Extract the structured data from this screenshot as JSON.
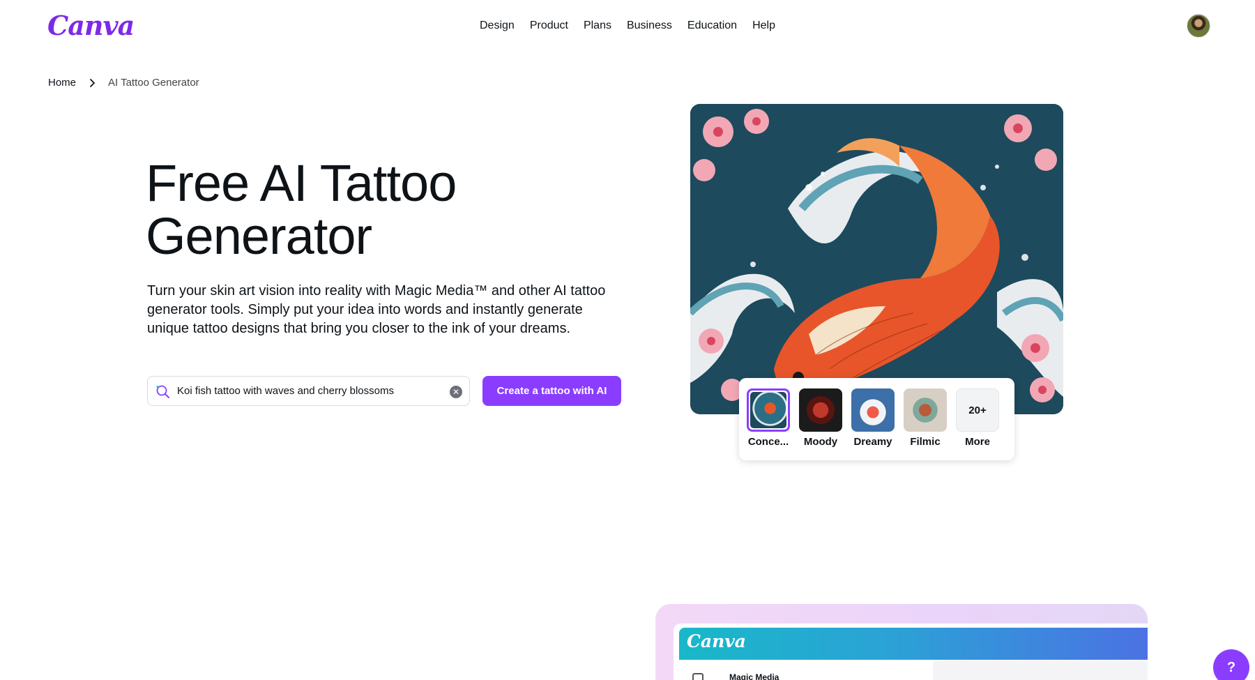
{
  "header": {
    "logo_text": "Canva",
    "nav": [
      "Design",
      "Product",
      "Plans",
      "Business",
      "Education",
      "Help"
    ],
    "avatar_icon": "user-avatar"
  },
  "breadcrumb": {
    "home": "Home",
    "current": "AI Tattoo Generator"
  },
  "hero": {
    "title": "Free AI Tattoo Generator",
    "description": "Turn your skin art vision into reality with Magic Media™ and other AI tattoo generator tools. Simply put your idea into words and instantly generate unique tattoo designs that bring you closer to the ink of your dreams.",
    "search_value": "Koi fish tattoo with waves and cherry blossoms",
    "cta_label": "Create a tattoo with AI"
  },
  "styles": {
    "items": [
      {
        "label": "Conce...",
        "selected": true
      },
      {
        "label": "Moody",
        "selected": false
      },
      {
        "label": "Dreamy",
        "selected": false
      },
      {
        "label": "Filmic",
        "selected": false
      }
    ],
    "more_count": "20+",
    "more_label": "More"
  },
  "preview": {
    "logo_text": "Canva",
    "panel_label": "Magic Media"
  },
  "help_button": "?",
  "colors": {
    "brand_purple": "#8b3dff",
    "text": "#0e1318",
    "art_background": "#1d4a5c",
    "koi_orange": "#e8552a"
  }
}
